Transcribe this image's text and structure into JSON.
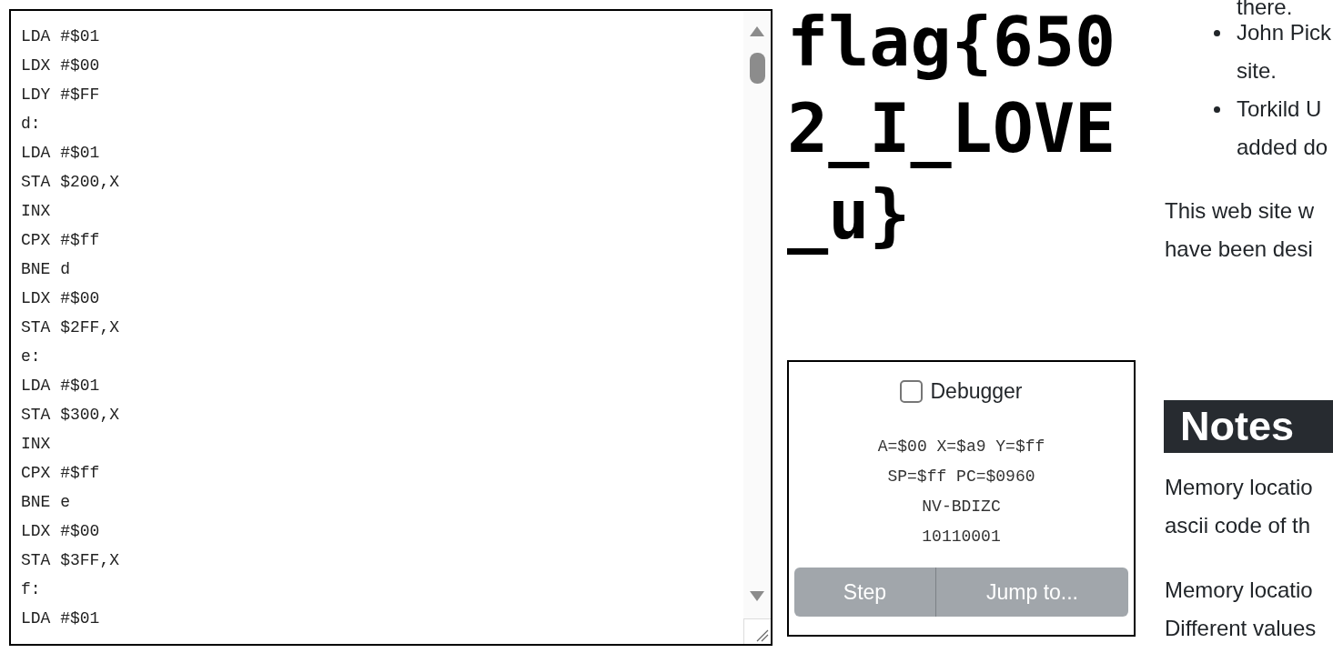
{
  "editor": {
    "lines": [
      "LDA #$01",
      "LDX #$00",
      "LDY #$FF",
      "d:",
      "LDA #$01",
      "STA $200,X",
      "INX",
      "CPX #$ff",
      "BNE d",
      "LDX #$00",
      "STA $2FF,X",
      "e:",
      "LDA #$01",
      "STA $300,X",
      "INX",
      "CPX #$ff",
      "BNE e",
      "LDX #$00",
      "STA $3FF,X",
      "f:",
      "LDA #$01"
    ]
  },
  "screen": {
    "lines": [
      "flag{650",
      "2_I_LOVE",
      "_u}"
    ]
  },
  "debugger": {
    "label": "Debugger",
    "checked": false,
    "registers": [
      "A=$00 X=$a9 Y=$ff",
      "SP=$ff PC=$0960",
      "NV-BDIZC",
      "10110001"
    ],
    "buttons": [
      {
        "label": "Step",
        "disabled": true
      },
      {
        "label": "Jump to...",
        "disabled": true
      }
    ]
  },
  "article": {
    "fragment": "there.",
    "bullets": [
      {
        "lines": [
          "John Pick",
          "site."
        ]
      },
      {
        "lines": [
          "Torkild U",
          "added do"
        ]
      }
    ],
    "paragraphs": [
      {
        "lines": [
          "This web site w",
          "have been desi"
        ]
      }
    ],
    "notes": {
      "heading": "Notes",
      "paragraphs": [
        {
          "lines": [
            "Memory locatio",
            "ascii code of th"
          ]
        },
        {
          "lines": [
            "Memory locatio",
            "Different values"
          ]
        }
      ]
    }
  }
}
